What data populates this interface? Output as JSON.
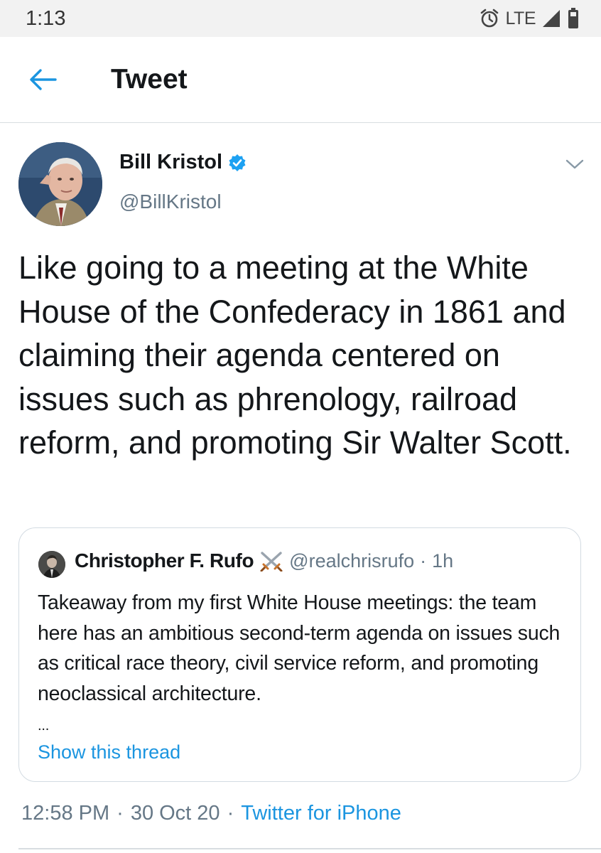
{
  "status_bar": {
    "time": "1:13",
    "network": "LTE",
    "icons": [
      "alarm-icon",
      "signal-icon",
      "battery-icon"
    ]
  },
  "header": {
    "back_icon": "arrow-left-icon",
    "title": "Tweet"
  },
  "tweet": {
    "author": {
      "name": "Bill Kristol",
      "verified": true,
      "handle": "@BillKristol"
    },
    "text": "Like going to a meeting at the White House of the Confederacy in 1861 and claiming their agenda centered on issues such as phrenology, railroad reform, and promoting Sir Walter Scott.",
    "timestamp": "12:58 PM",
    "date": "30 Oct 20",
    "source": "Twitter for iPhone"
  },
  "quoted_tweet": {
    "name": "Christopher F. Rufo",
    "name_emoji": "⚔️",
    "handle": "@realchrisrufo",
    "separator": "·",
    "time": "1h",
    "text": "Takeaway from my first White House meetings: the team here has an ambitious second-term agenda on issues such as critical race theory, civil service reform, and promoting neoclassical architecture.",
    "ellipsis": "...",
    "show_thread": "Show this thread"
  },
  "colors": {
    "link_blue": "#1b95e0",
    "secondary_text": "#657786",
    "primary_text": "#14171a",
    "divider": "#d8dde1",
    "status_bar_bg": "#f2f2f2"
  }
}
